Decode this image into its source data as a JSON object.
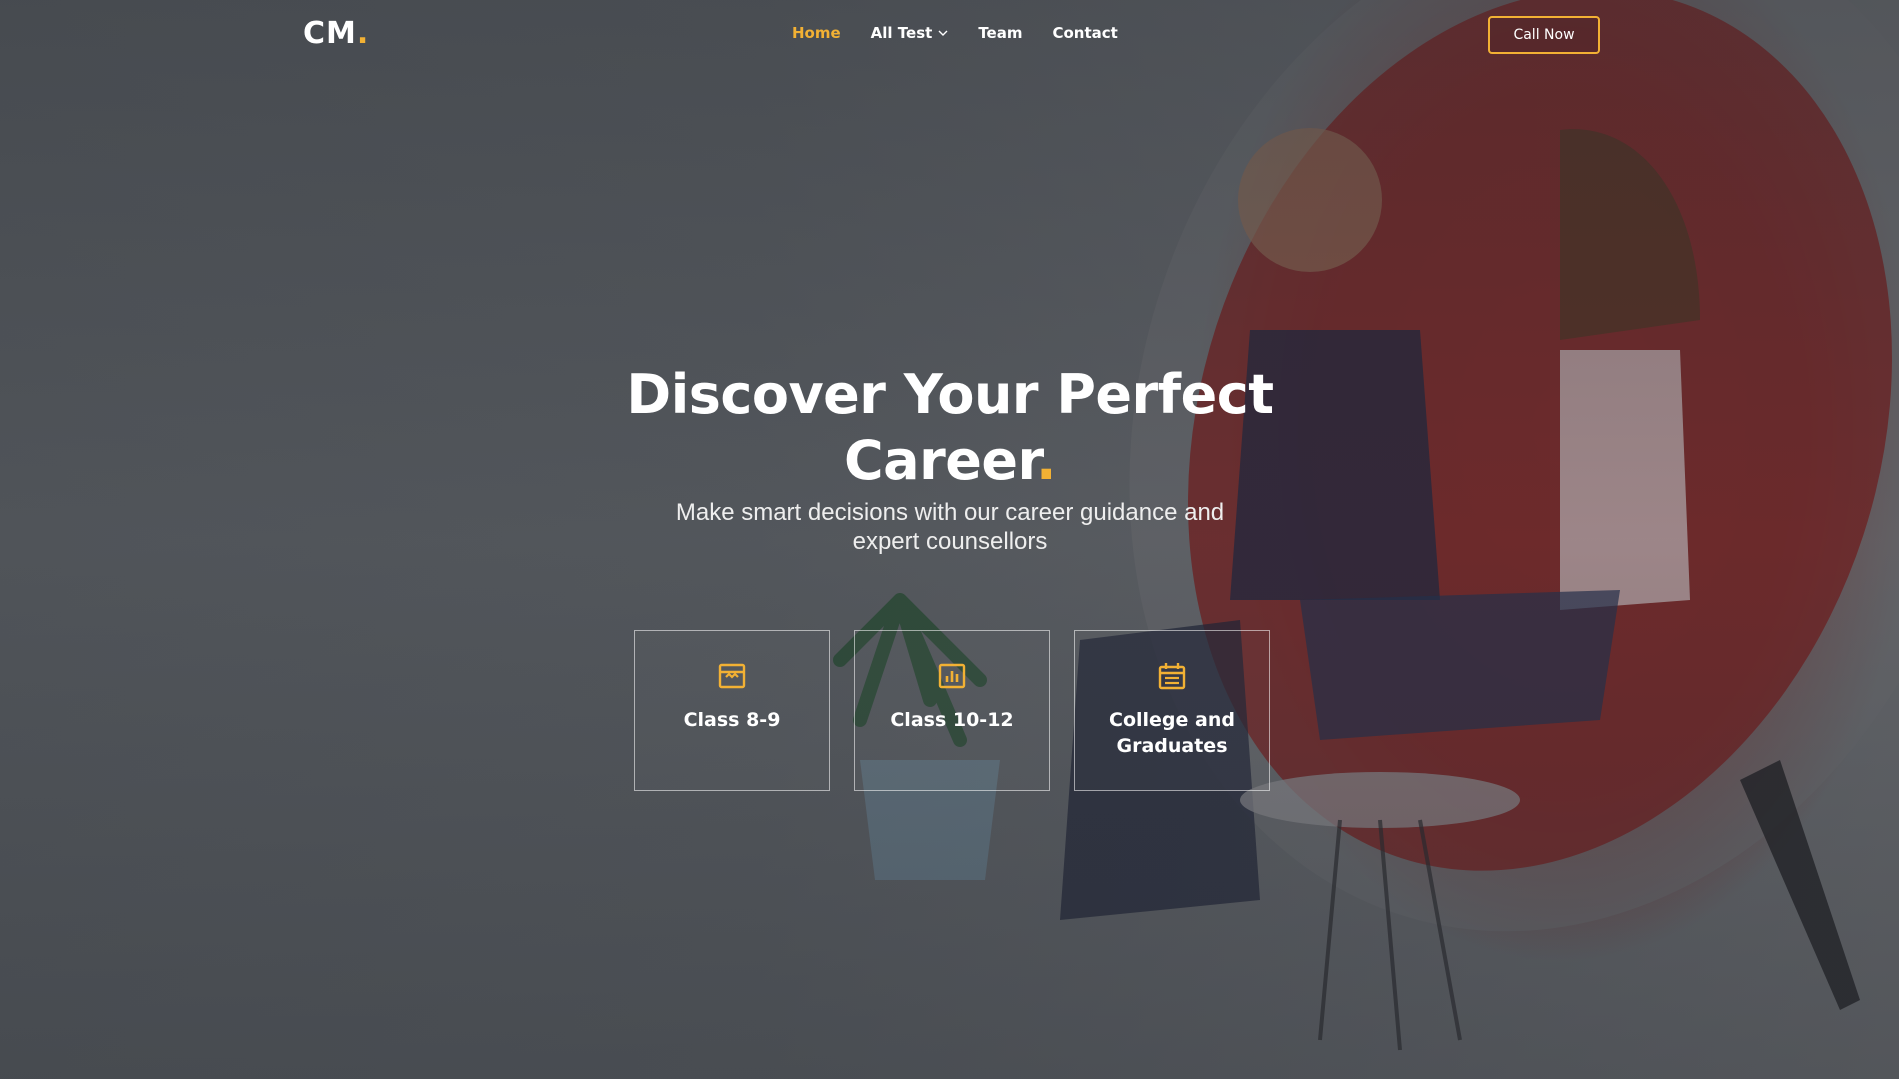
{
  "brand": {
    "logo_text": "CM",
    "logo_dot": "."
  },
  "nav": {
    "items": [
      {
        "label": "Home",
        "active": true
      },
      {
        "label": "All Test",
        "has_dropdown": true
      },
      {
        "label": "Team"
      },
      {
        "label": "Contact"
      }
    ],
    "cta_label": "Call Now"
  },
  "hero": {
    "title_line1": "Discover Your Perfect",
    "title_line2": "Career",
    "title_dot": ".",
    "subtitle": "Make smart decisions with our career guidance and expert counsellors"
  },
  "cards": [
    {
      "label": "Class 8-9",
      "icon": "archive-icon"
    },
    {
      "label": "Class 10-12",
      "icon": "bar-chart-icon"
    },
    {
      "label": "College and Graduates",
      "icon": "calendar-icon"
    }
  ],
  "colors": {
    "accent": "#f2b134",
    "background": "#54585d",
    "chair_red": "#8a1f1f"
  }
}
